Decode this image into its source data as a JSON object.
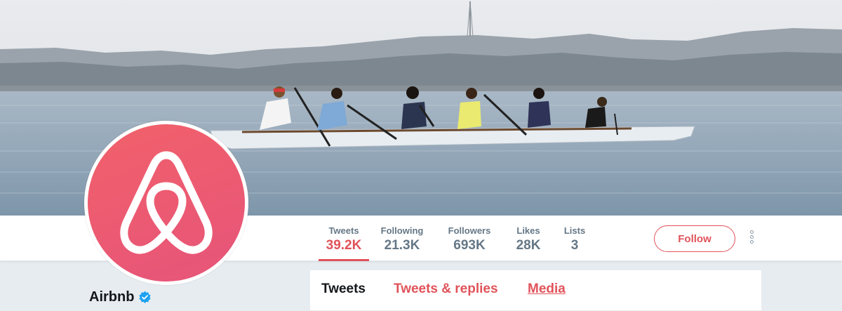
{
  "stats": [
    {
      "label": "Tweets",
      "value": "39.2K"
    },
    {
      "label": "Following",
      "value": "21.3K"
    },
    {
      "label": "Followers",
      "value": "693K"
    },
    {
      "label": "Likes",
      "value": "28K"
    },
    {
      "label": "Lists",
      "value": "3"
    }
  ],
  "actions": {
    "follow_label": "Follow"
  },
  "profile": {
    "name": "Airbnb",
    "verified": true
  },
  "timeline_tabs": [
    {
      "label": "Tweets"
    },
    {
      "label": "Tweets & replies"
    },
    {
      "label": "Media"
    }
  ],
  "colors": {
    "accent": "#e0535a",
    "avatar": "#f2616a",
    "verified": "#1da1f2"
  },
  "icons": {
    "more": "more-vertical-icon",
    "verified": "verified-badge-icon",
    "logo": "airbnb-belo-logo"
  }
}
